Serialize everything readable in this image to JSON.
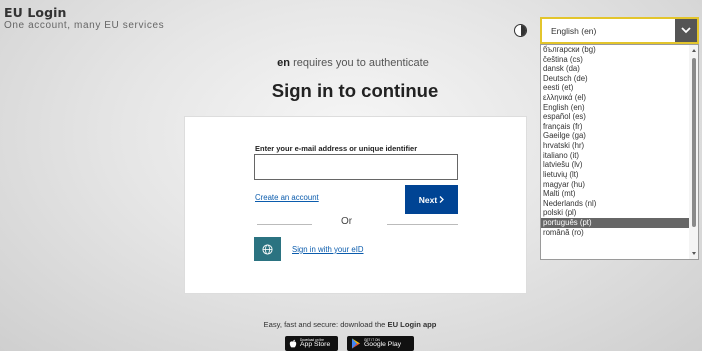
{
  "brand": {
    "title": "EU Login",
    "subtitle": "One account, many EU services"
  },
  "language": {
    "selected": "English (en)",
    "options": [
      "български (bg)",
      "čeština (cs)",
      "dansk (da)",
      "Deutsch (de)",
      "eesti (et)",
      "ελληνικά (el)",
      "English (en)",
      "español (es)",
      "français (fr)",
      "Gaeilge (ga)",
      "hrvatski (hr)",
      "italiano (it)",
      "latviešu (lv)",
      "lietuvių (lt)",
      "magyar (hu)",
      "Malti (mt)",
      "Nederlands (nl)",
      "polski (pl)",
      "português (pt)",
      "română (ro)"
    ],
    "highlighted": "português (pt)"
  },
  "auth": {
    "requester": "en",
    "requires_text": "requires you to authenticate",
    "heading": "Sign in to continue"
  },
  "form": {
    "field_label": "Enter your e-mail address or unique identifier",
    "field_value": "",
    "create_account": "Create an account",
    "next_label": "Next",
    "or_label": "Or",
    "eid_link": "Sign in with your eID"
  },
  "footer": {
    "text_prefix": "Easy, fast and secure: download the",
    "text_app": "EU Login app",
    "app_store_small": "Download on the",
    "app_store_big": "App Store",
    "google_play_small": "GET IT ON",
    "google_play_big": "Google Play"
  },
  "colors": {
    "primary_button": "#004494",
    "eid_button": "#2b7381",
    "select_focus_border": "#e3c52c",
    "link": "#0b5cad"
  }
}
